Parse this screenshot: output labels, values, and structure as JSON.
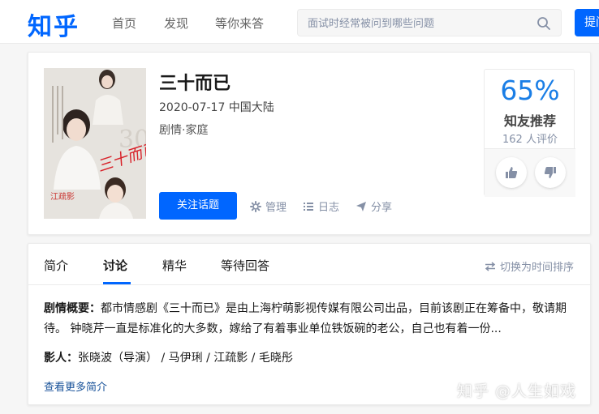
{
  "header": {
    "logo": "知乎",
    "nav": [
      "首页",
      "发现",
      "等你来答"
    ],
    "search_placeholder": "面试时经常被问到哪些问题",
    "ask_label": "提问"
  },
  "topic": {
    "title": "三十而已",
    "meta": "2020-07-17 中国大陆",
    "genre": "剧情·家庭",
    "follow_label": "关注话题",
    "actions": {
      "manage": "管理",
      "log": "日志",
      "share": "分享"
    },
    "poster_text": {
      "title": "三十而已",
      "actor": "江疏影"
    },
    "rating": {
      "percent": "65%",
      "label": "知友推荐",
      "count": "162 人评价"
    }
  },
  "discussion": {
    "tabs": [
      "简介",
      "讨论",
      "精华",
      "等待回答"
    ],
    "active_tab": "讨论",
    "sort_label": "切换为时间排序",
    "summary_label": "剧情概要：",
    "summary_text": "都市情感剧《三十而已》是由上海柠萌影视传媒有限公司出品，目前该剧正在筹备中，敬请期待。 钟晓芹一直是标准化的大多数，嫁给了有着事业单位铁饭碗的老公，自己也有着一份...",
    "cast_label": "影人：",
    "cast_text": "张晓波（导演） / 马伊琍 / 江疏影 / 毛晓彤",
    "more_label": "查看更多简介"
  },
  "watermark": "知乎 @人生如戏",
  "colors": {
    "brand": "#0066ff",
    "rating": "#1a7ee6",
    "link": "#175199"
  }
}
